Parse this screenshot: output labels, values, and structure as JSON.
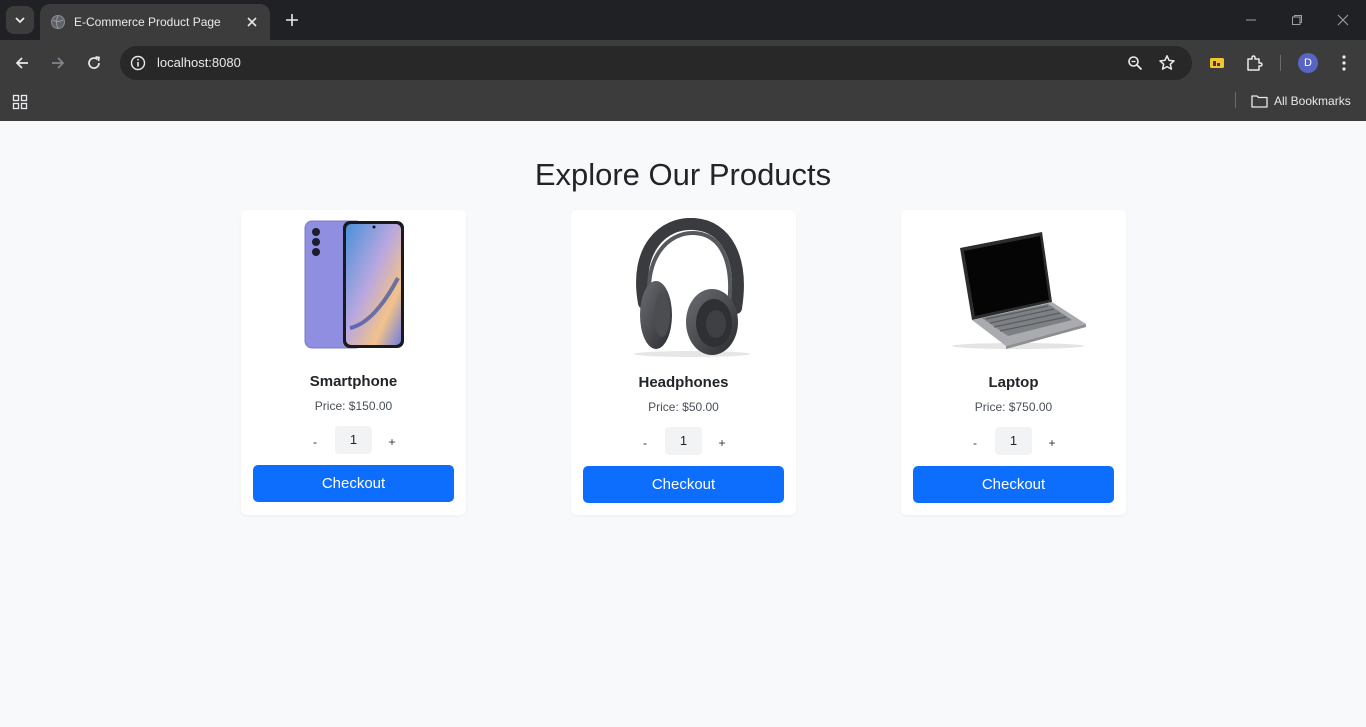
{
  "browser": {
    "tab_title": "E-Commerce Product Page",
    "url": "localhost:8080",
    "bookmarks_label": "All Bookmarks",
    "profile_initial": "D"
  },
  "page": {
    "heading": "Explore Our Products"
  },
  "products": [
    {
      "name": "Smartphone",
      "price": "Price: $150.00",
      "quantity": "1",
      "minus": "-",
      "plus": "+",
      "checkout": "Checkout",
      "image": "smartphone-image"
    },
    {
      "name": "Headphones",
      "price": "Price: $50.00",
      "quantity": "1",
      "minus": "-",
      "plus": "+",
      "checkout": "Checkout",
      "image": "headphones-image"
    },
    {
      "name": "Laptop",
      "price": "Price: $750.00",
      "quantity": "1",
      "minus": "-",
      "plus": "+",
      "checkout": "Checkout",
      "image": "laptop-image"
    }
  ],
  "colors": {
    "accent": "#0d6efd",
    "page_bg": "#f8f9fa",
    "chrome_dark": "#202124",
    "chrome_toolbar": "#3c3c3c"
  }
}
